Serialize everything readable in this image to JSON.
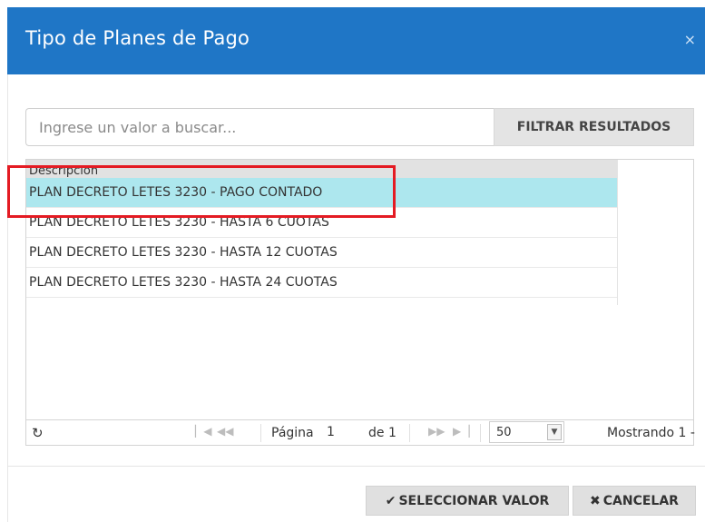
{
  "dialog": {
    "title": "Tipo de Planes de Pago",
    "close_label": "×"
  },
  "search": {
    "placeholder": "Ingrese un valor a buscar...",
    "value": "",
    "filter_label": "FILTRAR RESULTADOS"
  },
  "grid": {
    "column_header": "Descripcion",
    "rows": [
      "PLAN DECRETO LETES 3230 - PAGO CONTADO",
      "PLAN DECRETO LETES 3230 - HASTA 6 CUOTAS",
      "PLAN DECRETO LETES 3230 - HASTA 12 CUOTAS",
      "PLAN DECRETO LETES 3230 - HASTA 24 CUOTAS"
    ],
    "selected_index": 0
  },
  "pager": {
    "page_label": "Página",
    "page_value": "1",
    "of_label": "de 1",
    "page_size": "50",
    "showing_text": "Mostrando 1 -"
  },
  "actions": {
    "select_label": "SELECCIONAR VALOR",
    "cancel_label": "CANCELAR"
  },
  "icons": {
    "refresh": "refresh-icon",
    "first": "first-page-icon",
    "prev": "prev-page-icon",
    "next": "next-page-icon",
    "last": "last-page-icon",
    "check": "check-icon",
    "cancel": "x-icon",
    "dropdown": "chevron-down-icon"
  },
  "colors": {
    "header_bg": "#1f76c6",
    "selected_row": "#ade7ee",
    "highlight_box": "#e41b23"
  }
}
